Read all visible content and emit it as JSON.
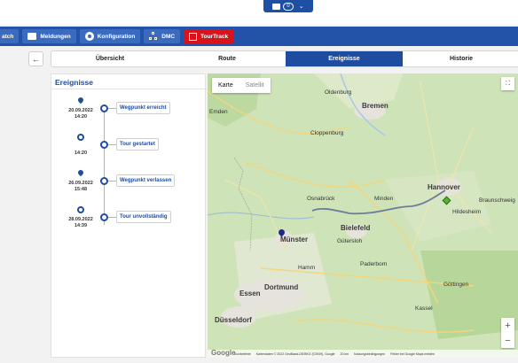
{
  "header": {
    "message_count": "0"
  },
  "nav": {
    "items": [
      {
        "label": "atch"
      },
      {
        "label": "Meldungen"
      },
      {
        "label": "Konfiguration"
      },
      {
        "label": "DMC"
      },
      {
        "label": "TourTrack"
      }
    ]
  },
  "tabs": [
    "Übersicht",
    "Route",
    "Ereignisse",
    "Historie"
  ],
  "active_tab": "Ereignisse",
  "events": {
    "title": "Ereignisse",
    "items": [
      {
        "icon": "pin-icon",
        "date": "20.09.2022",
        "time": "14:20",
        "label": "Wegpunkt erreicht"
      },
      {
        "icon": "target-icon",
        "date": "",
        "time": "14:20",
        "label": "Tour gestartet"
      },
      {
        "icon": "pin-icon",
        "date": "26.09.2022",
        "time": "15:48",
        "label": "Wegpunkt verlassen"
      },
      {
        "icon": "target-icon",
        "date": "28.09.2022",
        "time": "14:39",
        "label": "Tour unvollständig"
      }
    ]
  },
  "map": {
    "type_options": [
      "Karte",
      "Satellit"
    ],
    "selected_type": "Karte",
    "cities_major": [
      "Bremen",
      "Hannover",
      "Bielefeld",
      "Münster",
      "Dortmund",
      "Essen",
      "Düsseldorf"
    ],
    "cities_mid": [
      "Osnabrück",
      "Oldenburg",
      "Hildesheim",
      "Kassel",
      "Paderborn",
      "Hamm",
      "Göttingen",
      "Braunschweig",
      "Minden",
      "Cloppenburg",
      "Gütersloh",
      "Emden"
    ],
    "attribution": [
      "Kurzbefehle",
      "Kartendaten © 2022 GeoBasis-DE/BKG (©2009), Google",
      "20 km",
      "Nutzungsbedingungen",
      "Fehler bei Google Maps melden"
    ],
    "logo": "Google"
  },
  "colors": {
    "primary": "#1e4c9f",
    "nav": "#2253a8",
    "tourtrack": "#d9131c"
  }
}
